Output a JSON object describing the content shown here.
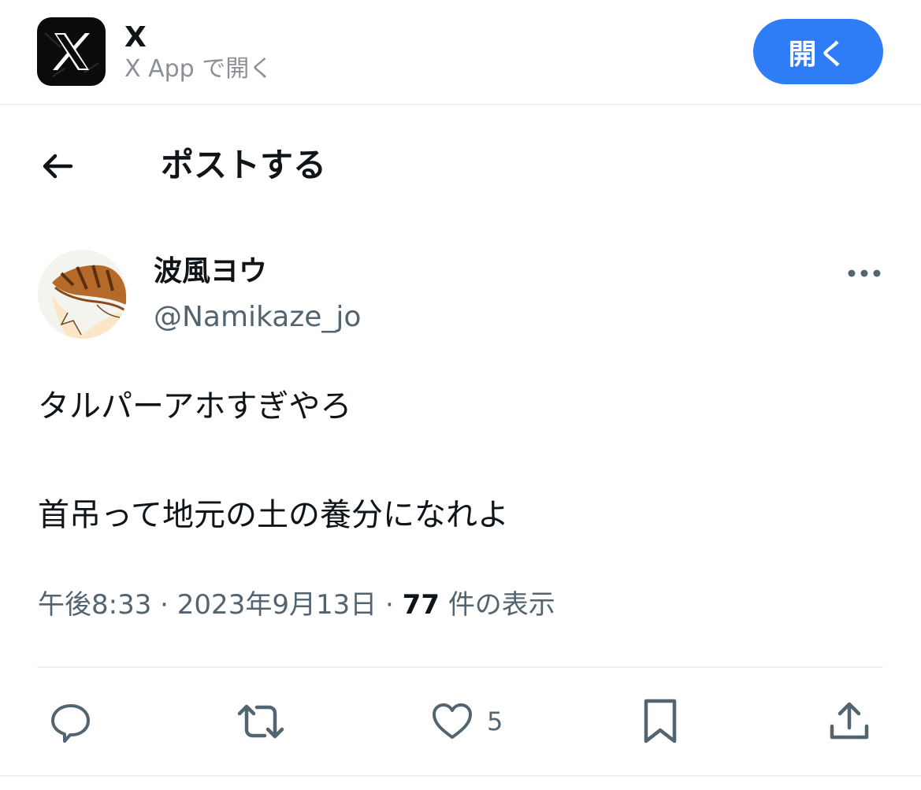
{
  "banner": {
    "app_name": "X",
    "app_subtitle": "X App で開く",
    "open_label": "開く",
    "open_button_color": "#2f7df6"
  },
  "header": {
    "title": "ポストする"
  },
  "author": {
    "display_name": "波風ヨウ",
    "handle": "@Namikaze_jo"
  },
  "tweet": {
    "lines": [
      "タルパーアホすぎやろ",
      "首吊って地元の土の養分になれよ"
    ]
  },
  "meta": {
    "time": "午後8:33",
    "separator": " · ",
    "date": "2023年9月13日",
    "views_count": "77",
    "views_label": "件の表示"
  },
  "actions": {
    "like_count": "5"
  },
  "icons": {
    "back": "arrow-left-icon",
    "more": "more-horizontal-icon",
    "reply": "reply-icon",
    "retweet": "retweet-icon",
    "like": "heart-icon",
    "bookmark": "bookmark-icon",
    "share": "share-icon"
  }
}
